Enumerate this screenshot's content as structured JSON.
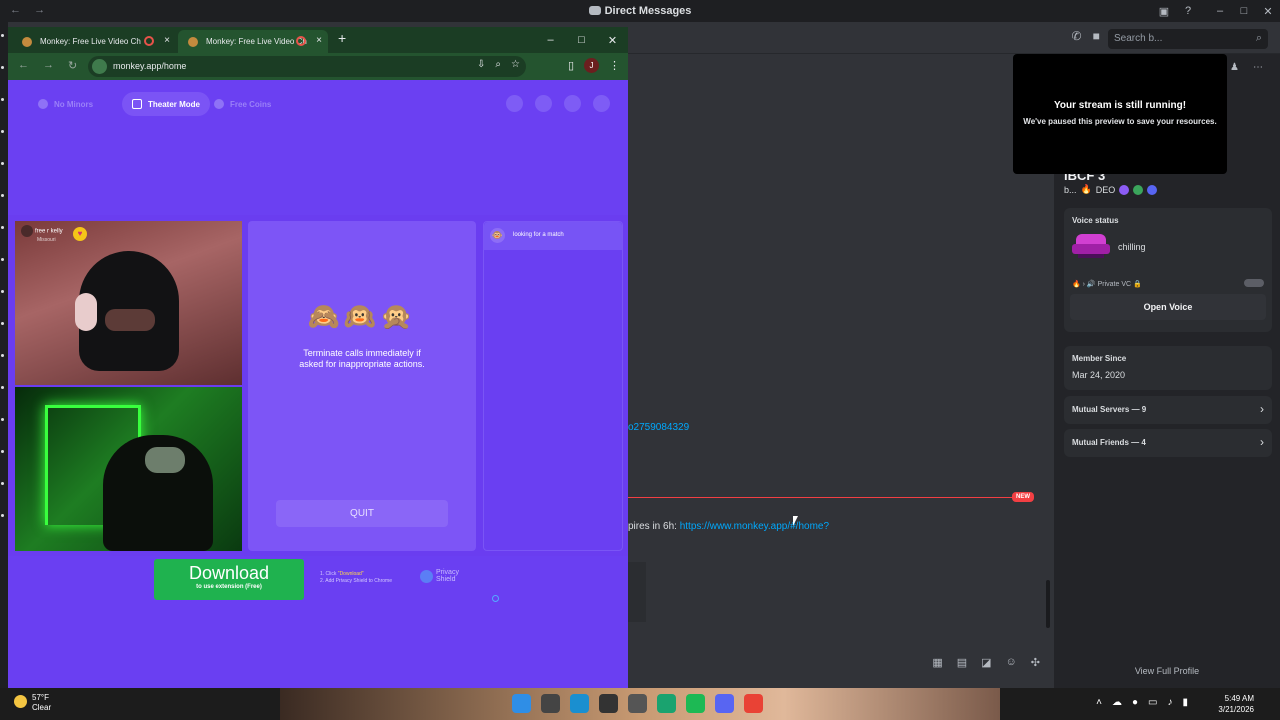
{
  "discord": {
    "window_title": "Direct Messages",
    "search_placeholder": "Search b...",
    "chat": {
      "link_fragment": "o2759084329",
      "new_badge": "NEW",
      "message_prefix": "pires in 6h:",
      "message_link": "https://www.monkey.app/#/home?"
    },
    "stream_notice": {
      "title": "Your stream is still running!",
      "subtitle": "We've paused this preview to save your resources."
    },
    "profile": {
      "name": "iBCF 3",
      "tag_prefix": "b...",
      "tag_badge": "DEO",
      "voice_status_label": "Voice status",
      "voice_status_text": "chilling",
      "vc_path": "Private VC",
      "open_voice": "Open Voice",
      "member_since_label": "Member Since",
      "member_since_value": "Mar 24, 2020",
      "mutual_servers": "Mutual Servers — 9",
      "mutual_friends": "Mutual Friends — 4",
      "view_full": "View Full Profile"
    }
  },
  "chrome": {
    "tabs": [
      {
        "label": "Monkey: Free Live Video Ch"
      },
      {
        "label": "Monkey: Free Live Video Ch"
      }
    ],
    "url": "monkey.app/home",
    "profile_initial": "J"
  },
  "monkey": {
    "top_pills": [
      "No Minors",
      "Theater Mode",
      "Free Coins"
    ],
    "user_name": "free r kelly",
    "user_location": "Missouri",
    "rule_text": "Terminate calls immediately if asked for inappropriate actions.",
    "quit_label": "QUIT",
    "chat_status": "looking for a match",
    "download_label": "Download",
    "download_sub": "to use extension (Free)",
    "steps_line1_a": "1. Click",
    "steps_line1_b": "\"Download\"",
    "steps_line2": "2. Add Privacy Shield to Chrome",
    "privacy_line1": "Privacy",
    "privacy_line2": "Shield"
  },
  "taskbar": {
    "temperature": "57°F",
    "weather": "Clear",
    "time": "5:49 AM",
    "date": "3/21/2026"
  },
  "colors": {
    "monkey_purple": "#6a3df0",
    "download_green": "#1fb24f",
    "discord_link": "#00a8fc",
    "new_red": "#f23f43"
  }
}
